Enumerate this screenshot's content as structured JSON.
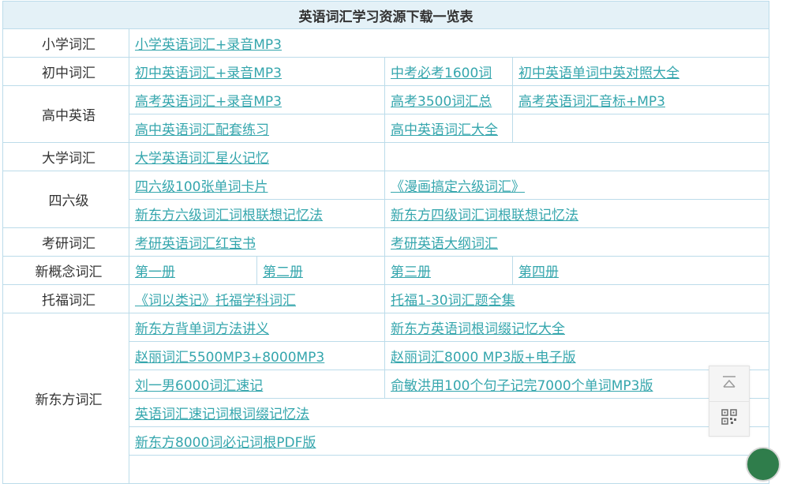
{
  "table": {
    "title": "英语词汇学习资源下载一览表",
    "categories": {
      "primary": "小学词汇",
      "junior": "初中词汇",
      "senior": "高中英语",
      "college": "大学词汇",
      "cet": "四六级",
      "kaoyan": "考研词汇",
      "nce": "新概念词汇",
      "toefl": "托福词汇",
      "xdf": "新东方词汇"
    },
    "links": {
      "primary_1": "小学英语词汇+录音MP3",
      "junior_1": "初中英语词汇+录音MP3",
      "junior_2": "中考必考1600词",
      "junior_3": "初中英语单词中英对照大全",
      "senior_1": "高考英语词汇+录音MP3",
      "senior_2": "高考3500词汇总",
      "senior_3": "高考英语词汇音标+MP3",
      "senior_4": "高中英语词汇配套练习",
      "senior_5": "高中英语词汇大全",
      "college_1": "大学英语词汇星火记忆",
      "cet_1": "四六级100张单词卡片",
      "cet_2": "《漫画搞定六级词汇》",
      "cet_3": "新东方六级词汇词根联想记忆法",
      "cet_4": "新东方四级词汇词根联想记忆法",
      "kaoyan_1": "考研英语词汇红宝书",
      "kaoyan_2": "考研英语大纲词汇",
      "nce_1": "第一册",
      "nce_2": "第二册",
      "nce_3": "第三册",
      "nce_4": "第四册",
      "toefl_1": "《词以类记》托福学科词汇",
      "toefl_2": "托福1-30词汇题全集",
      "xdf_1": "新东方背单词方法讲义",
      "xdf_2": "新东方英语词根词缀记忆大全",
      "xdf_3": "赵丽词汇5500MP3+8000MP3",
      "xdf_4": "赵丽词汇8000 MP3版+电子版",
      "xdf_5": "刘一男6000词汇速记",
      "xdf_6": "俞敏洪用100个句子记完7000个单词MP3版",
      "xdf_7": "英语词汇速记词根词缀记忆法",
      "xdf_8": "新东方8000词必记词根PDF版"
    }
  },
  "float_panel": {
    "top_icon": "back-to-top-icon",
    "qr_icon": "qr-code-icon"
  },
  "colors": {
    "link": "#35a6ad",
    "border": "#bcdcea",
    "header_bg": "#e4f1f7"
  }
}
